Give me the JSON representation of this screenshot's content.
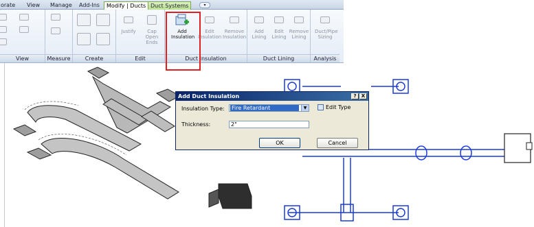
{
  "tabs": [
    {
      "label": "orate"
    },
    {
      "label": "View"
    },
    {
      "label": "Manage"
    },
    {
      "label": "Add-Ins"
    },
    {
      "label": "Modify | Ducts"
    },
    {
      "label": "Duct Systems"
    }
  ],
  "panels": {
    "view": "View",
    "measure": "Measure",
    "create": "Create",
    "edit": "Edit",
    "duct_insulation": "Duct Insulation",
    "duct_lining": "Duct Lining",
    "analysis": "Analysis"
  },
  "tools": {
    "justify": "Justify",
    "cap_open_ends": "Cap Open Ends",
    "add_insulation": "Add Insulation",
    "edit_insulation": "Edit Insulation",
    "remove_insulation": "Remove Insulation",
    "add_lining": "Add Lining",
    "edit_lining": "Edit Lining",
    "remove_lining": "Remove Lining",
    "duct_pipe_sizing": "Duct/Pipe Sizing"
  },
  "dialog": {
    "title": "Add Duct Insulation",
    "help_btn": "?",
    "close_btn": "X",
    "insulation_type_label": "Insulation Type:",
    "insulation_type_value": "Fire Retardant",
    "edit_type": "Edit Type",
    "thickness_label": "Thickness:",
    "thickness_value": "2\"",
    "ok": "OK",
    "cancel": "Cancel"
  },
  "colors": {
    "highlight": "#e02020",
    "plan": "#1a3ad8",
    "title_bar": "#0a246a"
  }
}
